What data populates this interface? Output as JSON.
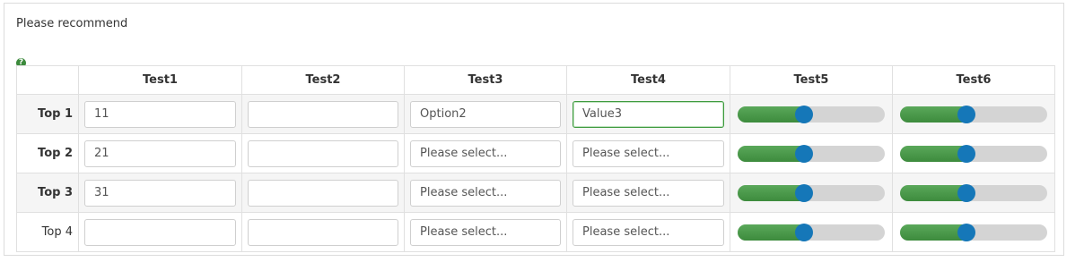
{
  "question": {
    "text": "Please recommend",
    "help_icon": "?"
  },
  "columns": [
    "Test1",
    "Test2",
    "Test3",
    "Test4",
    "Test5",
    "Test6"
  ],
  "rows": [
    {
      "label": "Top 1",
      "bold": true,
      "test1": "11",
      "test2": "",
      "test3": "Option2",
      "test4": "Value3",
      "test4_focused": true,
      "test5": 0.45,
      "test6": 0.45
    },
    {
      "label": "Top 2",
      "bold": true,
      "test1": "21",
      "test2": "",
      "test3": "Please select...",
      "test4": "Please select...",
      "test4_focused": false,
      "test5": 0.45,
      "test6": 0.45
    },
    {
      "label": "Top 3",
      "bold": true,
      "test1": "31",
      "test2": "",
      "test3": "Please select...",
      "test4": "Please select...",
      "test4_focused": false,
      "test5": 0.45,
      "test6": 0.45
    },
    {
      "label": "Top 4",
      "bold": false,
      "test1": "",
      "test2": "",
      "test3": "Please select...",
      "test4": "Please select...",
      "test4_focused": false,
      "test5": 0.45,
      "test6": 0.45
    }
  ],
  "colors": {
    "slider_fill": "#4a9a4a",
    "slider_thumb": "#1577b8",
    "focus_border": "#3f9a3f"
  }
}
